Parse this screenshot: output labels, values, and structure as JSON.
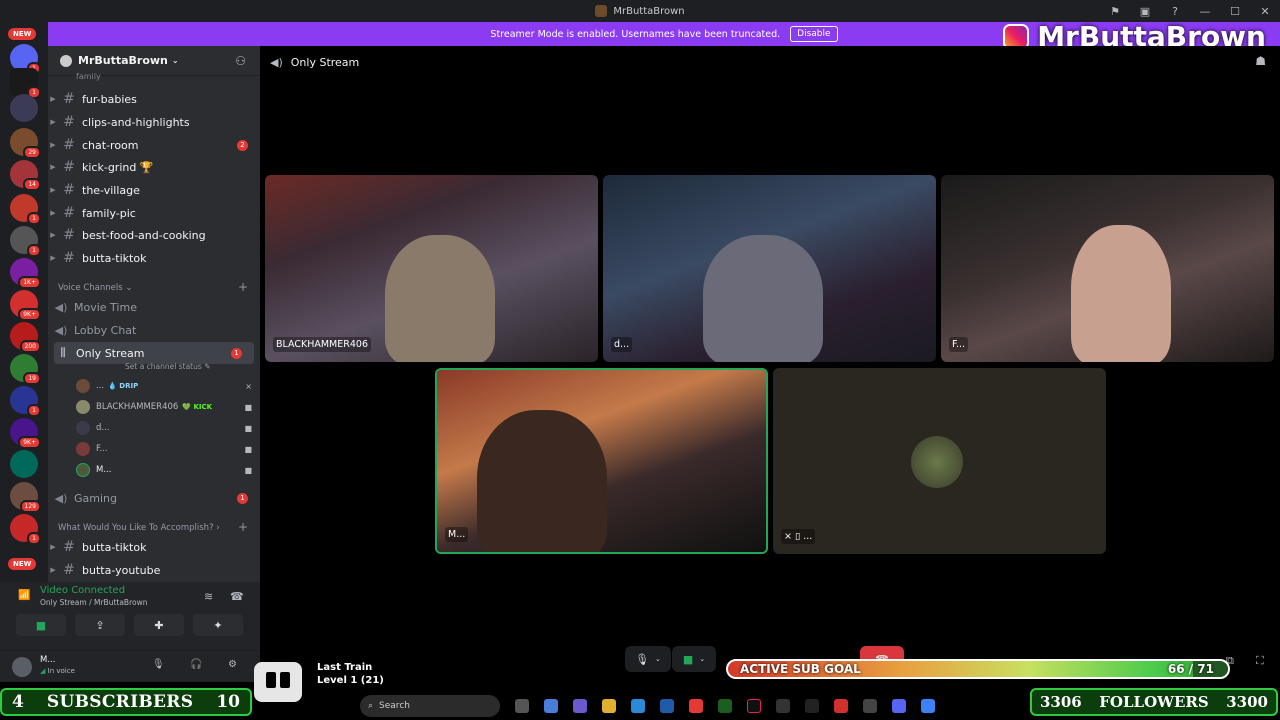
{
  "window": {
    "title": "MrButtaBrown"
  },
  "streamer_bar": {
    "message": "Streamer Mode is enabled. Usernames have been truncated.",
    "disable_label": "Disable"
  },
  "brand": {
    "name": "MrButtaBrown"
  },
  "guild_rail": {
    "new_labels": [
      "NEW",
      "NEW"
    ],
    "badges": [
      "1",
      "1",
      "29",
      "14",
      "1",
      "1",
      "1K+",
      "9K+",
      "200",
      "19",
      "1",
      "9K+",
      "129",
      "1",
      "1"
    ]
  },
  "server": {
    "name": "MrButtaBrown"
  },
  "text_channels_top": [
    {
      "name": "fur-babies"
    },
    {
      "name": "clips-and-highlights"
    },
    {
      "name": "chat-room",
      "count": "2"
    },
    {
      "name": "kick-grind 🏆"
    },
    {
      "name": "the-village"
    },
    {
      "name": "family-pic"
    },
    {
      "name": "best-food-and-cooking"
    },
    {
      "name": "butta-tiktok"
    }
  ],
  "partial_channel": "family",
  "voice_category": "Voice Channels",
  "voice_channels": [
    {
      "name": "Movie Time"
    },
    {
      "name": "Lobby Chat"
    },
    {
      "name": "Only Stream",
      "count": "1",
      "status": "Set a channel status"
    }
  ],
  "voice_users": [
    {
      "name": "...",
      "tag": "💧 DRIP"
    },
    {
      "name": "BLACKHAMMER406",
      "tag": "💚 KICK"
    },
    {
      "name": "d..."
    },
    {
      "name": "F..."
    },
    {
      "name": "M..."
    }
  ],
  "gaming_channel": {
    "name": "Gaming",
    "count": "1"
  },
  "accomplish_category": "What Would You Like To Accomplish?",
  "text_channels_bottom": [
    {
      "name": "butta-tiktok"
    },
    {
      "name": "butta-youtube"
    }
  ],
  "voice_panel": {
    "title": "Video Connected",
    "subtitle": "Only Stream / MrButtaBrown"
  },
  "user_panel": {
    "name": "M...",
    "status": "In voice"
  },
  "main": {
    "channel": "Only Stream"
  },
  "tiles": [
    {
      "label": "BLACKHAMMER406"
    },
    {
      "label": "d..."
    },
    {
      "label": "F..."
    },
    {
      "label": "M..."
    },
    {
      "label": "..."
    }
  ],
  "overlay": {
    "subscribers_left": "4",
    "subscribers_label": "SUBSCRIBERS",
    "subscribers_right": "10",
    "followers_left": "3306",
    "followers_label": "FOLLOWERS",
    "followers_right": "3300",
    "sub_goal_label": "ACTIVE SUB GOAL",
    "sub_goal_count": "66 / 71",
    "sub_goal_progress": 0.93
  },
  "track": {
    "title": "Last Train",
    "level": "Level 1 (21)"
  },
  "taskbar": {
    "search_placeholder": "Search"
  },
  "colors": {
    "accent": "#8b3cf2",
    "online": "#23a55a",
    "badge": "#e53935"
  }
}
